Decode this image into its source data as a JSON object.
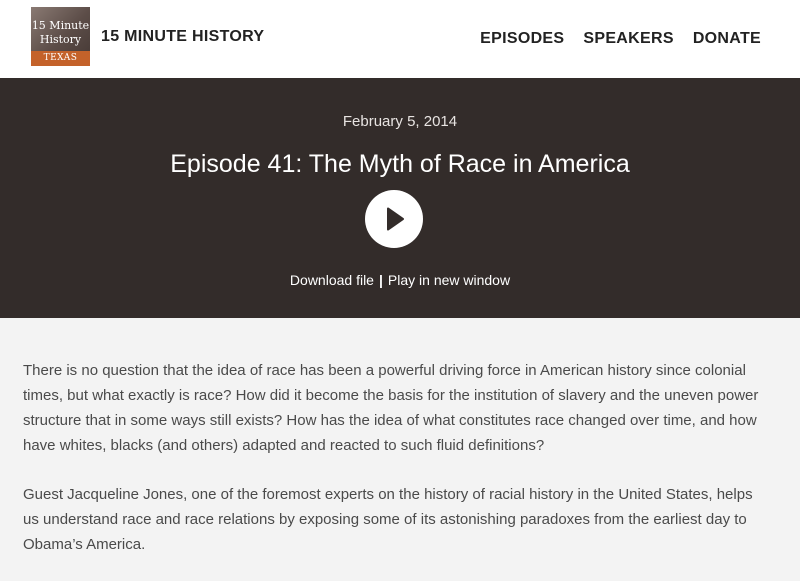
{
  "header": {
    "logo": {
      "line1": "15 Minute",
      "line2": "History",
      "sub": "TEXAS"
    },
    "site_title": "15 MINUTE HISTORY",
    "nav": [
      "EPISODES",
      "SPEAKERS",
      "DONATE"
    ]
  },
  "episode": {
    "date": "February 5, 2014",
    "title": "Episode 41: The Myth of Race in America",
    "download_label": "Download file",
    "separator": "|",
    "play_new_window_label": "Play in new window"
  },
  "content": {
    "paragraphs": [
      "There is no question that the idea of race has been a powerful driving force in American history since colonial times, but what exactly is race? How did it become the basis for the institution of slavery and the uneven power structure that in some ways still exists? How has the idea of what constitutes race changed over time, and how have whites, blacks (and others) adapted and reacted to such fluid definitions?",
      "Guest Jacqueline Jones, one of the foremost experts on the history of racial history in the United States, helps us understand race and race relations by exposing some of its astonishing paradoxes from the earliest day to Obama’s America."
    ]
  },
  "colors": {
    "hero_bg": "#332c2a",
    "logo_accent": "#c4622a",
    "page_bg": "#f3f3f3"
  },
  "icons": {
    "play": "play-icon"
  }
}
